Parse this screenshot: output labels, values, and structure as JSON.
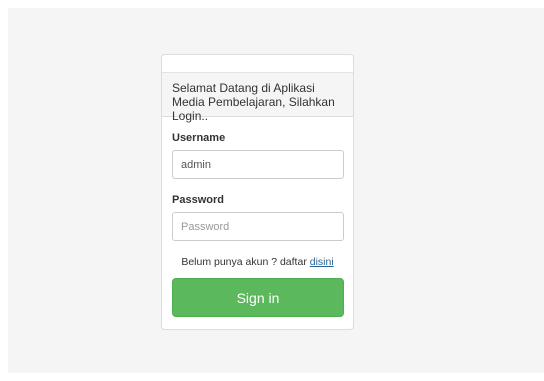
{
  "login": {
    "heading": "Selamat Datang di Aplikasi Media Pembelajaran, Silahkan Login..",
    "username_label": "Username",
    "username_value": "admin",
    "password_label": "Password",
    "password_placeholder": "Password",
    "register_prompt": "Belum punya akun ? daftar ",
    "register_link": "disini",
    "signin_label": "Sign in"
  },
  "colors": {
    "page_background": "#f5f5f5",
    "heading_background": "#f5f5f5",
    "signin_button": "#5cb85c",
    "link": "#2a6496"
  }
}
